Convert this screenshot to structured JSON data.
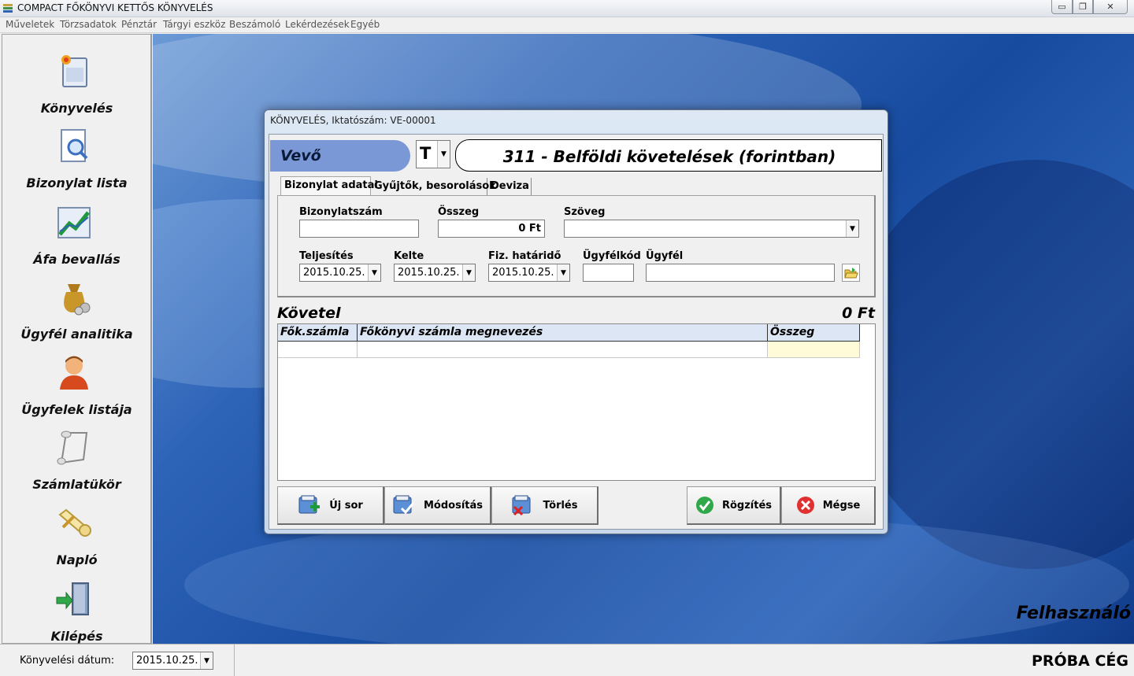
{
  "window": {
    "title": "COMPACT FŐKÖNYVI KETTŐS KÖNYVELÉS",
    "controls": {
      "minimize": "▭",
      "maximize": "❐",
      "close": "✕"
    }
  },
  "menu": [
    "Műveletek",
    "Törzsadatok",
    "Pénztár",
    "Tárgyi eszköz",
    "Beszámoló",
    "Lekérdezések",
    "Egyéb"
  ],
  "sidebar": [
    {
      "label": "Könyvelés",
      "icon": "ledger-book-icon"
    },
    {
      "label": "Bizonylat lista",
      "icon": "document-magnifier-icon"
    },
    {
      "label": "Áfa bevallás",
      "icon": "growth-chart-icon"
    },
    {
      "label": "Ügyfél analitika",
      "icon": "money-bag-icon"
    },
    {
      "label": "Ügyfelek listája",
      "icon": "person-icon"
    },
    {
      "label": "Számlatükör",
      "icon": "scroll-icon"
    },
    {
      "label": "Napló",
      "icon": "rolled-scroll-icon"
    },
    {
      "label": "Kilépés",
      "icon": "exit-door-icon"
    }
  ],
  "desktop": {
    "user_label": "Felhasználó"
  },
  "status": {
    "date_label": "Könyvelési dátum:",
    "date_value": "2015.10.25.",
    "company": "PRÓBA CÉG"
  },
  "dialog": {
    "title": "KÖNYVELÉS, Iktatószám: VE-00001",
    "party": "Vevő",
    "type_value": "T",
    "account": "311 - Belföldi követelések (forintban)",
    "tabs": [
      "Bizonylat adatai",
      "Gyűjtők, besorolások",
      "Deviza"
    ],
    "active_tab": 0,
    "fields": {
      "doc_number": {
        "label": "Bizonylatszám",
        "value": ""
      },
      "amount": {
        "label": "Összeg",
        "value": "0 Ft"
      },
      "text": {
        "label": "Szöveg",
        "value": ""
      },
      "fulfillment": {
        "label": "Teljesítés",
        "value": "2015.10.25."
      },
      "issued": {
        "label": "Kelte",
        "value": "2015.10.25."
      },
      "due": {
        "label": "Fiz. határidő",
        "value": "2015.10.25."
      },
      "client_code": {
        "label": "Ügyfélkód",
        "value": ""
      },
      "client": {
        "label": "Ügyfél",
        "value": ""
      }
    },
    "grid": {
      "title": "Követel",
      "total": "0 Ft",
      "columns": [
        "Fők.számla",
        "Főkönyvi számla megnevezés",
        "Összeg"
      ],
      "rows": [
        [
          "",
          "",
          ""
        ]
      ]
    },
    "buttons": {
      "new_row": "Új sor",
      "modify": "Módosítás",
      "delete": "Törlés",
      "save": "Rögzítés",
      "cancel": "Mégse"
    }
  },
  "colors": {
    "party_bg": "#7b98d6",
    "grid_header": "#dce6f4",
    "amount_cell": "#fffbd8",
    "desktop": "#1f55a8"
  }
}
